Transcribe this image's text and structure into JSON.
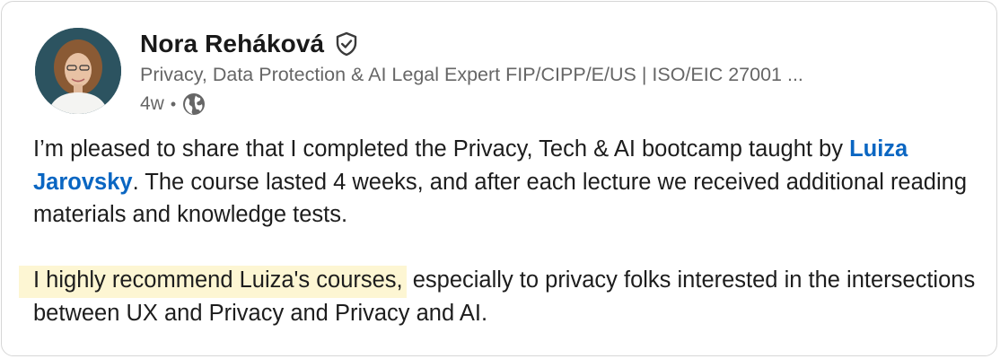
{
  "post": {
    "author": {
      "name": "Nora Reháková",
      "headline": "Privacy, Data Protection & AI Legal Expert FIP/CIPP/E/US | ISO/EIC 27001 ...",
      "time": "4w",
      "separator": "•"
    },
    "icons": {
      "verified": "verified-shield-icon",
      "visibility": "globe-icon"
    },
    "body": {
      "p1_before_mention": "I’m pleased to share that I completed the Privacy, Tech & AI bootcamp taught by ",
      "mention": "Luiza Jarovsky",
      "p1_after_mention": ". The course lasted 4 weeks, and after each lecture we received additional reading materials and knowledge tests.",
      "p2_highlight": "I highly recommend Luiza's courses,",
      "p2_rest": " especially to privacy folks interested in the intersections between UX and Privacy and Privacy and AI."
    },
    "colors": {
      "mention": "#0a66c2",
      "highlight": "#fdf6d3",
      "secondary_text": "#666666"
    }
  }
}
